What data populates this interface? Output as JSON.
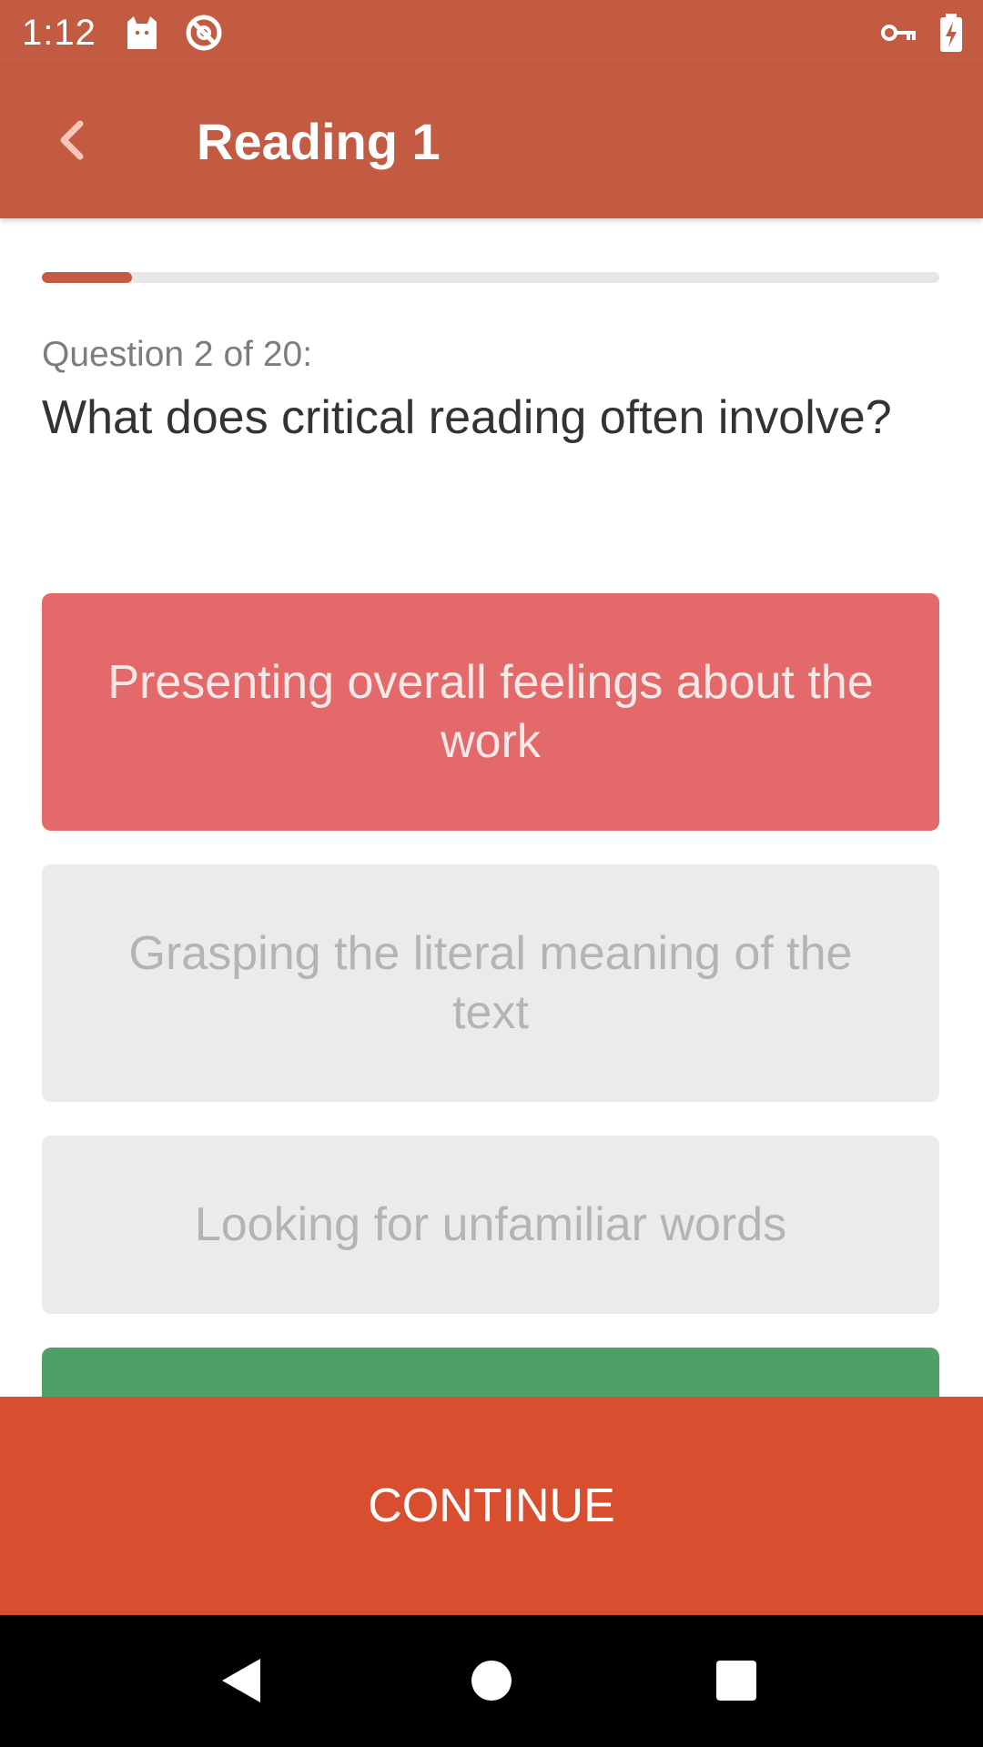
{
  "status_bar": {
    "time": "1:12",
    "left_icons": [
      "cat-notification-icon",
      "no-disturb-icon"
    ],
    "right_icons": [
      "vpn-key-icon",
      "battery-charging-icon"
    ]
  },
  "app_bar": {
    "title": "Reading 1",
    "back_icon": "chevron-left-icon"
  },
  "quiz": {
    "progress_fraction": 0.1,
    "counter": "Question 2 of 20:",
    "question": "What does critical reading often involve?",
    "answers": [
      {
        "label": "Presenting overall feelings about the work",
        "state": "wrong"
      },
      {
        "label": "Grasping the literal meaning of the text",
        "state": "neutral"
      },
      {
        "label": "Looking for unfamiliar words",
        "state": "neutral"
      },
      {
        "label": "",
        "state": "correct"
      }
    ]
  },
  "continue_label": "CONTINUE",
  "colors": {
    "primary": "#C35A42",
    "continue": "#D94E2F",
    "wrong": "#E4696A",
    "correct": "#4F9F66",
    "neutral": "#EBEBEB"
  },
  "nav_bar": {
    "buttons": [
      "back-triangle-icon",
      "home-circle-icon",
      "recents-square-icon"
    ]
  }
}
